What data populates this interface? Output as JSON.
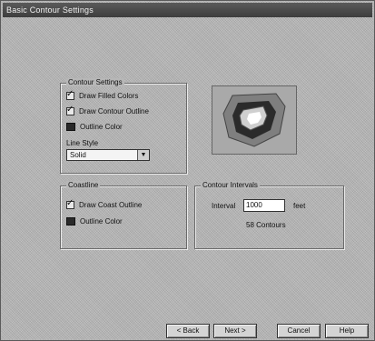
{
  "window": {
    "title": "Basic Contour Settings"
  },
  "contour_settings": {
    "group_title": "Contour Settings",
    "draw_filled_colors": {
      "label": "Draw Filled Colors",
      "checked": true
    },
    "draw_contour_outline": {
      "label": "Draw Contour Outline",
      "checked": true
    },
    "outline_color": {
      "label": "Outline Color",
      "color": "#2a2a2a"
    },
    "line_style": {
      "label": "Line Style",
      "value": "Solid"
    }
  },
  "coastline": {
    "group_title": "Coastline",
    "draw_coast_outline": {
      "label": "Draw Coast Outline",
      "checked": true
    },
    "outline_color": {
      "label": "Outline Color",
      "color": "#2a2a2a"
    }
  },
  "contour_intervals": {
    "group_title": "Contour Intervals",
    "interval_label": "Interval",
    "interval_value": "1000",
    "unit": "feet",
    "summary": "58 Contours"
  },
  "buttons": {
    "back": "< Back",
    "next": "Next >",
    "cancel": "Cancel",
    "help": "Help"
  },
  "preview": {
    "icon": "contour-preview-icon"
  }
}
